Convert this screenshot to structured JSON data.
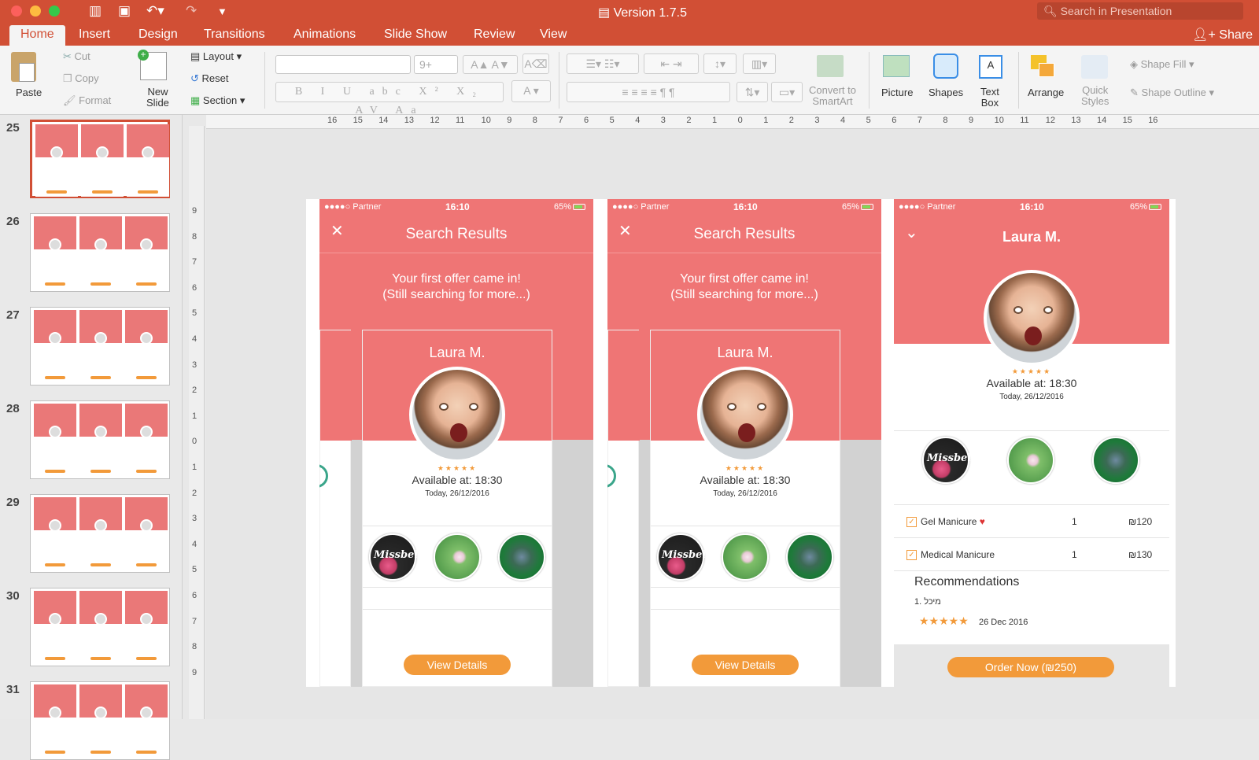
{
  "window": {
    "title": "Version 1.7.5",
    "search_placeholder": "Search in Presentation",
    "share": "Share"
  },
  "tabs": [
    "Home",
    "Insert",
    "Design",
    "Transitions",
    "Animations",
    "Slide Show",
    "Review",
    "View"
  ],
  "ribbon": {
    "paste": "Paste",
    "cut": "Cut",
    "copy": "Copy",
    "format": "Format",
    "new_slide_l1": "New",
    "new_slide_l2": "Slide",
    "layout": "Layout",
    "reset": "Reset",
    "section": "Section",
    "font_size": "9+",
    "convert_l1": "Convert to",
    "convert_l2": "SmartArt",
    "picture": "Picture",
    "shapes": "Shapes",
    "textbox_l1": "Text",
    "textbox_l2": "Box",
    "arrange": "Arrange",
    "quick_l1": "Quick",
    "quick_l2": "Styles",
    "shape_fill": "Shape Fill",
    "shape_outline": "Shape Outline"
  },
  "slides": [
    {
      "num": "25",
      "selected": true
    },
    {
      "num": "26"
    },
    {
      "num": "27"
    },
    {
      "num": "28"
    },
    {
      "num": "29"
    },
    {
      "num": "30"
    },
    {
      "num": "31"
    }
  ],
  "rulers": {
    "h": [
      "16",
      "15",
      "14",
      "13",
      "12",
      "11",
      "10",
      "9",
      "8",
      "7",
      "6",
      "5",
      "4",
      "3",
      "2",
      "1",
      "0",
      "1",
      "2",
      "3",
      "4",
      "5",
      "6",
      "7",
      "8",
      "9",
      "10",
      "11",
      "12",
      "13",
      "14",
      "15",
      "16"
    ],
    "v": [
      "9",
      "8",
      "7",
      "6",
      "5",
      "4",
      "3",
      "2",
      "1",
      "0",
      "1",
      "2",
      "3",
      "4",
      "5",
      "6",
      "7",
      "8",
      "9"
    ]
  },
  "phone": {
    "carrier": "Partner",
    "time": "16:10",
    "battery": "65%",
    "search_title": "Search Results",
    "offer_l1": "Your first offer came in!",
    "offer_l2": "(Still searching for more...)",
    "name": "Laura M.",
    "stars": "★★★★★",
    "available": "Available at: 18:30",
    "date": "Today, 26/12/2016",
    "brand": "Missbelez",
    "view_details": "View Details",
    "services": [
      {
        "name": "Gel Manicure",
        "qty": "1",
        "price": "₪120"
      },
      {
        "name": "Medical Manicure",
        "qty": "1",
        "price": "₪130"
      }
    ],
    "recommendations": "Recommendations",
    "rec_item": "1. מיכל",
    "rec_date": "26 Dec 2016",
    "order": "Order Now (₪250)"
  },
  "colors": {
    "accent": "#d14f35",
    "pink": "#ef7575",
    "orange": "#f29a3a"
  }
}
